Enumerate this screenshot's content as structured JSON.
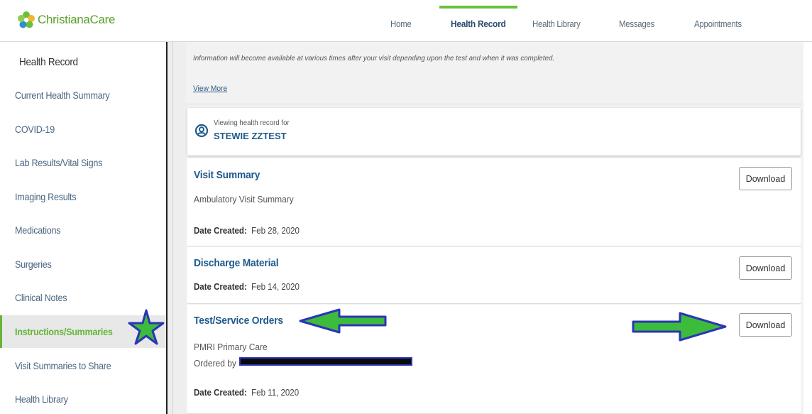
{
  "brand": {
    "logo_text_1": "Christiana",
    "logo_text_2": "Care"
  },
  "nav": {
    "items": [
      "Home",
      "Health Record",
      "Health Library",
      "Messages",
      "Appointments"
    ],
    "active": "Health Record"
  },
  "sidebar": {
    "header": "Health Record",
    "items": [
      "Current Health Summary",
      "COVID-19",
      "Lab Results/Vital Signs",
      "Imaging Results",
      "Medications",
      "Surgeries",
      "Clinical Notes",
      "Instructions/Summaries",
      "Visit Summaries to Share",
      "Health Library"
    ],
    "active": "Instructions/Summaries"
  },
  "info": {
    "text": "Information will become available at various times after your visit depending upon the test and when it was completed.",
    "view_more": "View More"
  },
  "patient": {
    "label": "Viewing health record for",
    "name": "STEWIE ZZTEST"
  },
  "documents": [
    {
      "title": "Visit Summary",
      "subtitle": "Ambulatory Visit Summary",
      "date_label": "Date Created:",
      "date": "Feb 28, 2020",
      "button": "Download"
    },
    {
      "title": "Discharge Material",
      "date_label": "Date Created:",
      "date": "Feb 14, 2020",
      "button": "Download"
    },
    {
      "title": "Test/Service Orders",
      "subtitle": "PMRI Primary Care",
      "ordered_by_label": "Ordered by",
      "date_label": "Date Created:",
      "date": "Feb 11, 2020",
      "button": "Download"
    }
  ],
  "colors": {
    "brand_green": "#66b536",
    "link_blue": "#1f5a8c",
    "annotation_blue": "#2c35b5",
    "annotation_green": "#3dbb3d"
  },
  "icons": {
    "logo": "christianacare-flower-logo",
    "patient": "person-circle-icon",
    "annotation_star": "star-annotation",
    "annotation_arrows": "arrow-annotation"
  }
}
